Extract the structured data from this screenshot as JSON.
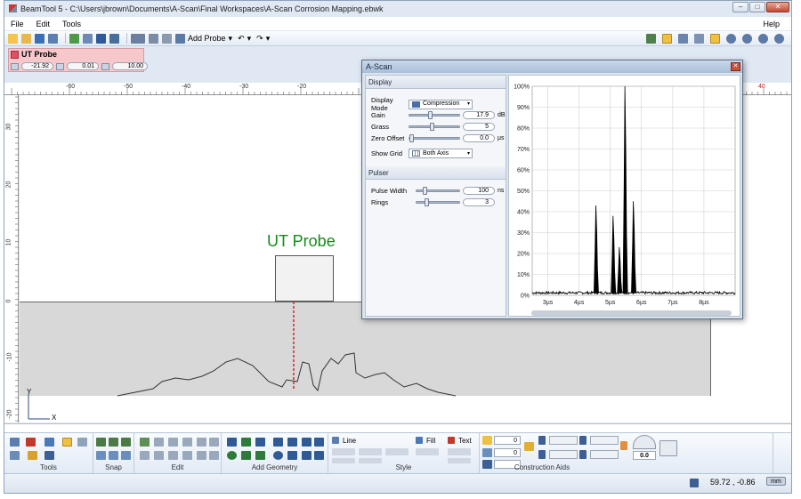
{
  "window": {
    "title": "BeamTool 5 - C:\\Users\\jbrown\\Documents\\A-Scan\\Final Workspaces\\A-Scan Corrosion Mapping.ebwk",
    "controls": [
      "minimize",
      "maximize",
      "close"
    ]
  },
  "menu": {
    "file": "File",
    "edit": "Edit",
    "tools": "Tools",
    "help": "Help"
  },
  "toolbar": {
    "add_probe": "Add Probe"
  },
  "probe_panel": {
    "title": "UT Probe",
    "x": "-21.92",
    "angle": "0.01",
    "width": "10.00"
  },
  "ruler": {
    "top_ticks": [
      "-60",
      "-50",
      "-40",
      "-30",
      "-20",
      "40"
    ],
    "left_ticks": [
      "30",
      "20",
      "10",
      "0",
      "-10",
      "-20"
    ]
  },
  "canvas": {
    "probe_label": "UT Probe",
    "axis_x": "X",
    "axis_y": "Y"
  },
  "ascan": {
    "title": "A-Scan",
    "display": {
      "section": "Display",
      "display_mode_label": "Display Mode",
      "display_mode_value": "Compression",
      "gain_label": "Gain",
      "gain_value": "17.9",
      "gain_unit": "dB",
      "gain_level": 0.4,
      "grass_label": "Grass",
      "grass_value": "5",
      "grass_level": 0.45,
      "zero_offset_label": "Zero Offset",
      "zero_offset_value": "0.0",
      "zero_offset_unit": "µs",
      "zero_offset_level": 0.0,
      "show_grid_label": "Show Grid",
      "show_grid_value": "Both Axis"
    },
    "pulser": {
      "section": "Pulser",
      "pulse_width_label": "Pulse Width",
      "pulse_width_value": "100",
      "pulse_width_unit": "ns",
      "pulse_width_level": 0.15,
      "rings_label": "Rings",
      "rings_value": "3",
      "rings_level": 0.2
    }
  },
  "chart_data": {
    "type": "line",
    "title": "",
    "xlabel": "",
    "ylabel": "",
    "x_ticks": [
      "3µs",
      "4µs",
      "5µs",
      "6µs",
      "7µs",
      "8µs"
    ],
    "y_ticks": [
      "0%",
      "10%",
      "20%",
      "30%",
      "40%",
      "50%",
      "60%",
      "70%",
      "80%",
      "90%",
      "100%"
    ],
    "xlim": [
      2.5,
      9.0
    ],
    "ylim": [
      0,
      100
    ],
    "grid": true,
    "peaks": [
      {
        "x": 4.55,
        "y": 43
      },
      {
        "x": 5.1,
        "y": 38
      },
      {
        "x": 5.3,
        "y": 23
      },
      {
        "x": 5.48,
        "y": 100
      },
      {
        "x": 5.75,
        "y": 45
      }
    ],
    "line_color": "#000000"
  },
  "ribbon": {
    "groups": [
      "Tools",
      "Snap",
      "Edit",
      "Add Geometry",
      "Style",
      "Construction Aids"
    ],
    "line_label": "Line",
    "fill_label": "Fill",
    "text_label": "Text",
    "field1": "0",
    "field2": "0",
    "angle_value": "0.0"
  },
  "status": {
    "coords": "59.72 , -0.86",
    "unit": "mm"
  }
}
